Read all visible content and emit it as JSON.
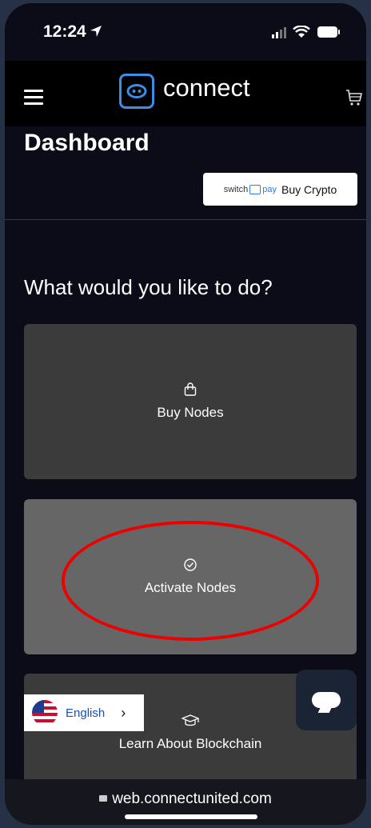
{
  "status": {
    "time": "12:24"
  },
  "header": {
    "logo_text": "connect"
  },
  "page": {
    "title": "Dashboard",
    "switchpay": {
      "brand_left": "switch",
      "brand_right": "pay",
      "label": "Buy Crypto"
    },
    "question": "What would you like to do?"
  },
  "cards": [
    {
      "label": "Buy Nodes",
      "icon": "shopping-bag-icon"
    },
    {
      "label": "Activate Nodes",
      "icon": "check-circle-icon"
    },
    {
      "label": "Learn About Blockchain",
      "icon": "graduation-cap-icon"
    }
  ],
  "language": {
    "label": "English"
  },
  "browser": {
    "url": "web.connectunited.com"
  },
  "colors": {
    "accent": "#3a8ee6",
    "highlight": "#e00000"
  }
}
